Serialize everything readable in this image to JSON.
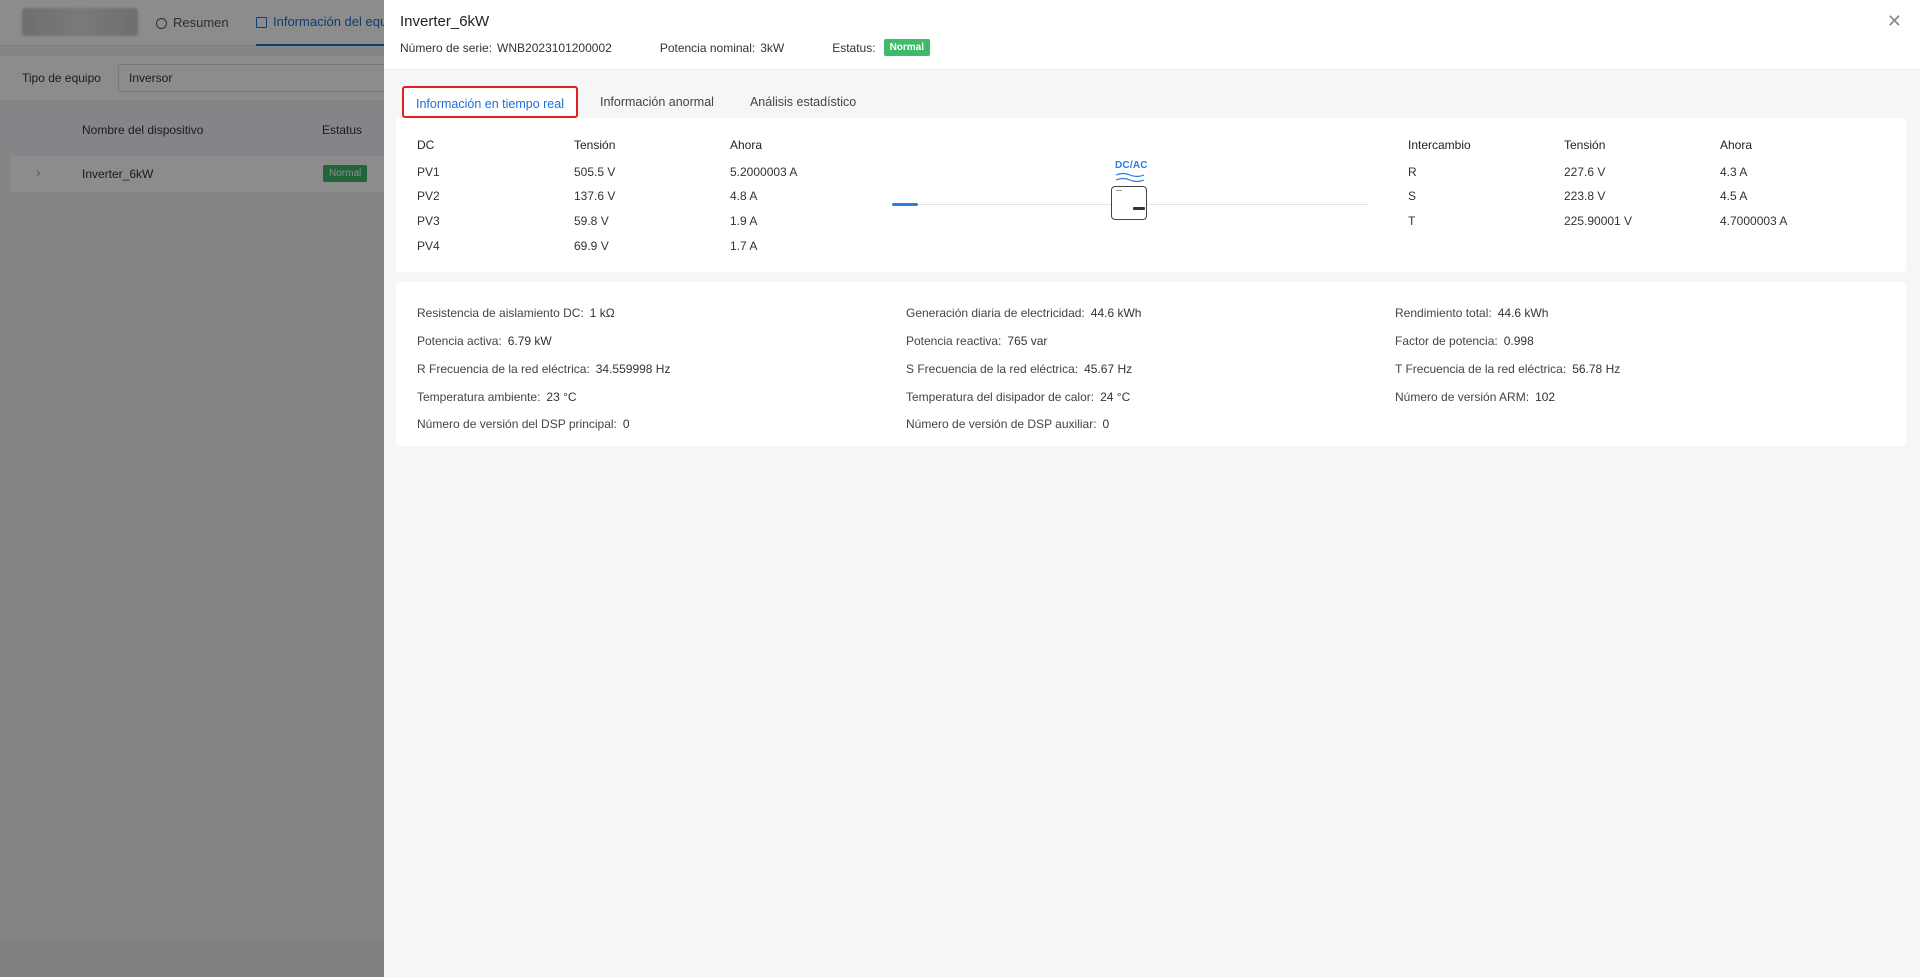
{
  "background": {
    "tabs": [
      {
        "label": "Resumen"
      },
      {
        "label": "Información del equ"
      }
    ],
    "filter": {
      "label": "Tipo de equipo",
      "value": "Inversor"
    },
    "table": {
      "headers": [
        "Nombre del dispositivo",
        "Estatus"
      ],
      "rows": [
        {
          "name": "Inverter_6kW",
          "status": "Normal"
        }
      ]
    }
  },
  "drawer": {
    "title": "Inverter_6kW",
    "close_icon": "close-icon",
    "meta": {
      "serial_label": "Número de serie:",
      "serial_value": "WNB2023101200002",
      "power_label": "Potencia nominal:",
      "power_value": "3kW",
      "status_label": "Estatus:",
      "status_value": "Normal"
    },
    "tabs": [
      {
        "label": "Información en tiempo real",
        "active": true
      },
      {
        "label": "Información anormal",
        "active": false
      },
      {
        "label": "Análisis estadístico",
        "active": false
      }
    ],
    "dc_table": {
      "headers": [
        "DC",
        "Tensión",
        "Ahora"
      ],
      "rows": [
        [
          "PV1",
          "505.5 V",
          "5.2000003 A"
        ],
        [
          "PV2",
          "137.6 V",
          "4.8 A"
        ],
        [
          "PV3",
          "59.8 V",
          "1.9 A"
        ],
        [
          "PV4",
          "69.9 V",
          "1.7 A"
        ]
      ]
    },
    "diagram": {
      "label": "DC/AC"
    },
    "ac_table": {
      "headers": [
        "Intercambio",
        "Tensión",
        "Ahora"
      ],
      "rows": [
        [
          "R",
          "227.6 V",
          "4.3 A"
        ],
        [
          "S",
          "223.8 V",
          "4.5 A"
        ],
        [
          "T",
          "225.90001 V",
          "4.7000003 A"
        ]
      ]
    },
    "details": [
      [
        {
          "k": "Resistencia de aislamiento DC:",
          "v": "1 kΩ"
        },
        {
          "k": "Potencia activa:",
          "v": "6.79 kW"
        },
        {
          "k": "R Frecuencia de la red eléctrica:",
          "v": "34.559998 Hz"
        },
        {
          "k": "Temperatura ambiente:",
          "v": "23 °C"
        },
        {
          "k": "Número de versión del DSP principal:",
          "v": "0"
        }
      ],
      [
        {
          "k": "Generación diaria de electricidad:",
          "v": "44.6 kWh"
        },
        {
          "k": "Potencia reactiva:",
          "v": "765 var"
        },
        {
          "k": "S Frecuencia de la red eléctrica:",
          "v": "45.67 Hz"
        },
        {
          "k": "Temperatura del disipador de calor:",
          "v": "24 °C"
        },
        {
          "k": "Número de versión de DSP auxiliar:",
          "v": "0"
        }
      ],
      [
        {
          "k": "Rendimiento total:",
          "v": "44.6 kWh"
        },
        {
          "k": "Factor de potencia:",
          "v": "0.998"
        },
        {
          "k": "T Frecuencia de la red eléctrica:",
          "v": "56.78 Hz"
        },
        {
          "k": "Número de versión ARM:",
          "v": "102"
        }
      ]
    ]
  },
  "colors": {
    "accent": "#1b6ed6",
    "status_green": "#3fb96a",
    "highlight_red": "#e02020"
  }
}
